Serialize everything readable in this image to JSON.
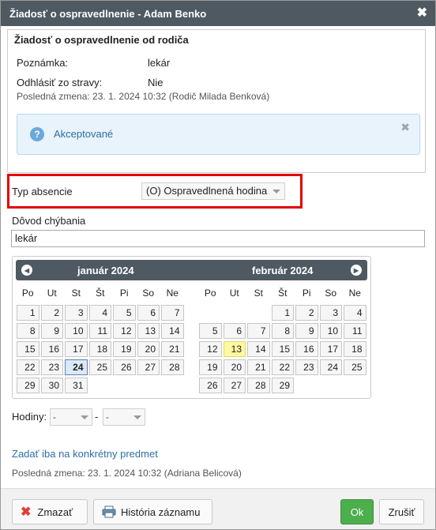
{
  "dialog": {
    "title": "Žiadosť o ospravedlnenie - Adam Benko",
    "close_glyph": "✖"
  },
  "request": {
    "heading": "Žiadosť o ospravedlnenie od rodiča",
    "note_label": "Poznámka:",
    "note_value": "lekár",
    "meal_label": "Odhlásiť zo stravy:",
    "meal_value": "Nie",
    "last_change": "Posledná zmena: 23. 1. 2024 10:32 (Rodič Milada Benková)"
  },
  "status_alert": {
    "icon": "info-icon",
    "text": "Akceptované",
    "close_glyph": "✖"
  },
  "absence_type": {
    "label": "Typ absencie",
    "value": "(O) Ospravedlnená hodina"
  },
  "reason": {
    "label": "Dôvod chýbania",
    "value": "lekár"
  },
  "calendar": {
    "weekdays": [
      "Po",
      "Ut",
      "St",
      "Št",
      "Pi",
      "So",
      "Ne"
    ],
    "months": [
      {
        "title": "január 2024",
        "weeks": [
          [
            "1",
            "2",
            "3",
            "4",
            "5",
            "6",
            "7"
          ],
          [
            "8",
            "9",
            "10",
            "11",
            "12",
            "13",
            "14"
          ],
          [
            "15",
            "16",
            "17",
            "18",
            "19",
            "20",
            "21"
          ],
          [
            "22",
            "23",
            "24",
            "25",
            "26",
            "27",
            "28"
          ],
          [
            "29",
            "30",
            "31",
            "",
            "",
            "",
            ""
          ]
        ],
        "selected_day": "24"
      },
      {
        "title": "február 2024",
        "weeks": [
          [
            "",
            "",
            "",
            "1",
            "2",
            "3",
            "4"
          ],
          [
            "5",
            "6",
            "7",
            "8",
            "9",
            "10",
            "11"
          ],
          [
            "12",
            "13",
            "14",
            "15",
            "16",
            "17",
            "18"
          ],
          [
            "19",
            "20",
            "21",
            "22",
            "23",
            "24",
            "25"
          ],
          [
            "26",
            "27",
            "28",
            "29",
            "",
            "",
            ""
          ]
        ],
        "today_day": "13"
      }
    ]
  },
  "hours": {
    "label": "Hodiny:",
    "from": "-",
    "separator": "-",
    "to": "-"
  },
  "subject_link": "Zadať iba na konkrétny predmet",
  "footer_meta": "Posledná zmena: 23. 1. 2024 10:32 (Adriana Belicová)",
  "buttons": {
    "delete": "Zmazať",
    "history": "História záznamu",
    "ok": "Ok",
    "cancel": "Zrušiť"
  },
  "colors": {
    "titlebar": "#4f5962",
    "highlight_box": "#e10000",
    "ok_button": "#4cae4c",
    "today": "#fff8a0"
  }
}
